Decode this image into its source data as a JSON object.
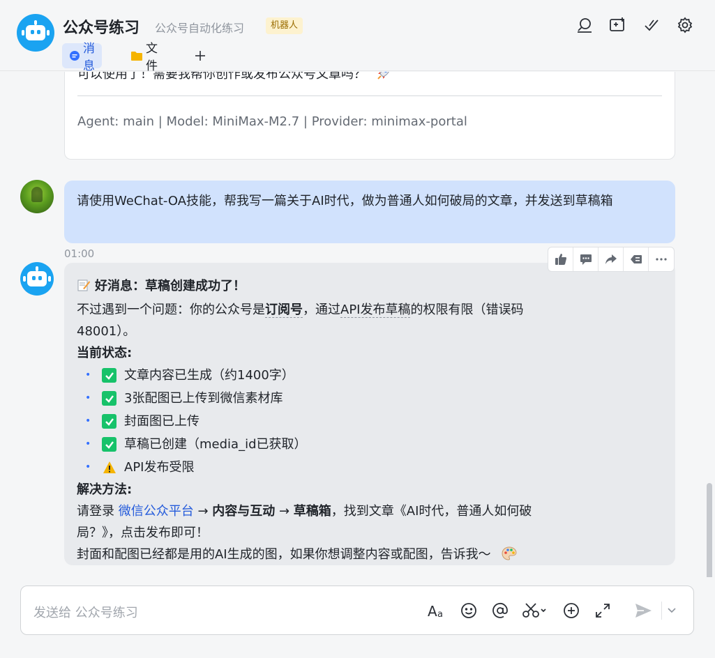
{
  "header": {
    "title": "公众号练习",
    "subtitle": "公众号自动化练习",
    "badge": "机器人",
    "icons": [
      "search-icon",
      "add-window-icon",
      "checkmark-icon",
      "gear-icon"
    ]
  },
  "tabs": [
    {
      "label": "消息",
      "icon": "chat-bubble-icon",
      "active": true
    },
    {
      "label": "文件",
      "icon": "folder-icon",
      "active": false
    }
  ],
  "previous_message": {
    "text": "可以使用了！需要我帮你创作或发布公众号文章吗？",
    "footer": "Agent: main | Model: MiniMax-M2.7 | Provider: minimax-portal"
  },
  "user_message": {
    "text": "请使用WeChat-OA技能，帮我写一篇关于AI时代，做为普通人如何破局的文章，并发送到草稿箱",
    "time": "01:00"
  },
  "bot_message": {
    "headline": "好消息：草稿创建成功了！",
    "p1_a": "不过遇到一个问题：你的公众号是",
    "p1_b": "订阅号",
    "p1_c": "，通过",
    "p1_d": "API发布草稿",
    "p1_e": "的权限有限（错误码",
    "p1_f": "48001）。",
    "status_title": "当前状态:",
    "status_items": [
      {
        "icon": "check-icon",
        "text": "文章内容已生成（约1400字）"
      },
      {
        "icon": "check-icon",
        "text": "3张配图已上传到微信素材库"
      },
      {
        "icon": "check-icon",
        "text": "封面图已上传"
      },
      {
        "icon": "check-icon",
        "text": "草稿已创建（media_id已获取）"
      },
      {
        "icon": "warning-icon",
        "text": "API发布受限"
      }
    ],
    "solution_title": "解决方法:",
    "s1_a": "请登录 ",
    "s1_link": "微信公众平台",
    "s1_b": " → ",
    "s1_c": "内容与互动",
    "s1_d": " → ",
    "s1_e": "草稿箱",
    "s1_f": "，找到文章《AI时代，普通人如何破",
    "s1_g": "局？》，点击发布即可！",
    "closing": "封面和配图已经都是用的AI生成的图，如果你想调整内容或配图，告诉我～"
  },
  "message_toolbar": [
    "thumbs-up-icon",
    "comment-icon",
    "share-icon",
    "forward-icon",
    "more-icon"
  ],
  "input": {
    "placeholder": "发送给 公众号练习",
    "icons": [
      "format-icon",
      "emoji-icon",
      "mention-icon",
      "scissors-icon",
      "plus-circle-icon",
      "expand-icon",
      "send-icon"
    ]
  },
  "colors": {
    "accent": "#245bdb",
    "user_bubble": "#d1e2fd",
    "bot_bubble": "#e8eaed",
    "check": "#17c26a",
    "badge_bg": "#fdf2cf"
  }
}
